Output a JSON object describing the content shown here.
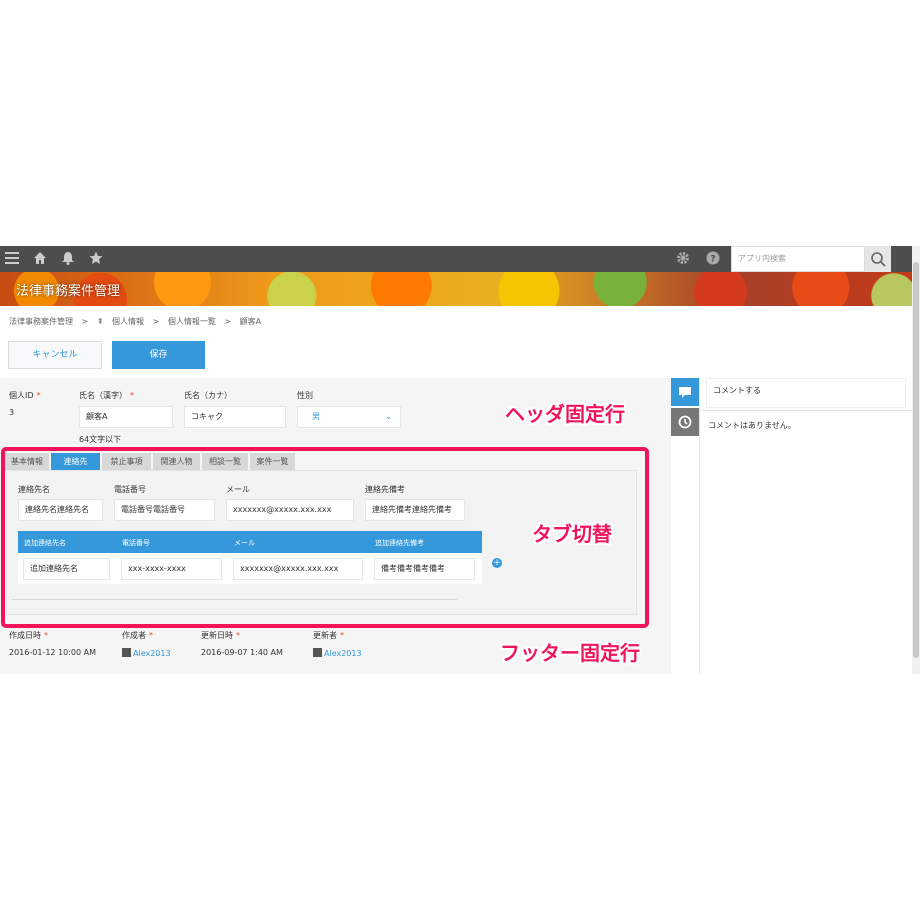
{
  "app": {
    "title": "法律事務案件管理"
  },
  "search": {
    "placeholder": "アプリ内検索"
  },
  "breadcrumb": [
    "法律事務案件管理",
    ">",
    "個人情報",
    ">",
    "個人情報一覧",
    ">",
    "顧客A"
  ],
  "actions": {
    "cancel": "キャンセル",
    "save": "保存"
  },
  "header_fields": {
    "id_label": "個人ID",
    "id_value": "3",
    "name_kanji_label": "氏名（漢字）",
    "name_kanji_value": "顧客A",
    "name_kanji_hint": "64文字以下",
    "name_kana_label": "氏名（カナ）",
    "name_kana_value": "コキャク",
    "gender_label": "性別",
    "gender_value": "男",
    "required_mark": "*"
  },
  "tabs": [
    "基本情報",
    "連絡先",
    "禁止事項",
    "関連人物",
    "相談一覧",
    "案件一覧"
  ],
  "active_tab": "連絡先",
  "contact": {
    "name_label": "連絡先名",
    "name_value": "連絡先名連絡先名",
    "phone_label": "電話番号",
    "phone_value": "電話番号電話番号",
    "mail_label": "メール",
    "mail_value": "xxxxxxx@xxxxx.xxx.xxx",
    "note_label": "連絡先備考",
    "note_value": "連絡先備考連絡先備考"
  },
  "sub_table": {
    "headers": [
      "追加連絡先名",
      "電話番号",
      "メール",
      "追加連絡先備考"
    ],
    "row": [
      "追加連絡先名",
      "xxx-xxxx-xxxx",
      "xxxxxxx@xxxxx.xxx.xxx",
      "備考備考備考備考"
    ]
  },
  "footer_fields": {
    "created_at_label": "作成日時",
    "created_at_value": "2016-01-12 10:00 AM",
    "creator_label": "作成者",
    "creator_value": "Alex2013",
    "updated_at_label": "更新日時",
    "updated_at_value": "2016-09-07 1:40 AM",
    "updater_label": "更新者",
    "updater_value": "Alex2013"
  },
  "comments": {
    "placeholder": "コメントする",
    "empty": "コメントはありません。"
  },
  "annotations": {
    "header": "ヘッダ固定行",
    "tabs": "タブ切替",
    "footer": "フッター固定行"
  },
  "colors": {
    "accent": "#3498db",
    "annotation": "#f0145a",
    "topbar": "#4d4d4d"
  }
}
